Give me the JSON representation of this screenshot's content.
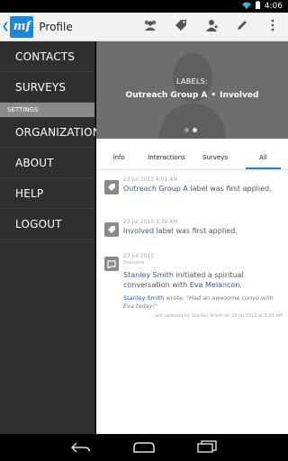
{
  "status_bar": {
    "time": "4:06"
  },
  "action_bar": {
    "logo_text": "mf",
    "title": "Profile",
    "icons": [
      "contacts-group-icon",
      "label-tag-icon",
      "person-icon",
      "edit-pencil-icon",
      "overflow-menu-icon"
    ]
  },
  "drawer": {
    "items_top": [
      {
        "label": "CONTACTS"
      },
      {
        "label": "SURVEYS"
      }
    ],
    "section_label": "SETTINGS",
    "items_bottom": [
      {
        "label": "ORGANIZATION"
      },
      {
        "label": "ABOUT"
      },
      {
        "label": "HELP"
      },
      {
        "label": "LOGOUT"
      }
    ]
  },
  "header": {
    "labels_heading": "LABELS:",
    "label_1": "Outreach Group A",
    "separator": "•",
    "label_2": "Involved",
    "page_dots": 2,
    "active_dot": 2
  },
  "tabs": [
    {
      "label": "Info",
      "active": false
    },
    {
      "label": "Interactions",
      "active": false
    },
    {
      "label": "Surveys",
      "active": false
    },
    {
      "label": "All",
      "active": true
    }
  ],
  "feed": [
    {
      "date": "23 Jul 2013 4:01 AM",
      "highlight": "Outreach Group A",
      "text": " label was first applied."
    },
    {
      "date": "23 Jul 2013 3:39 AM",
      "highlight": "Involved",
      "text": " label was first applied."
    },
    {
      "date": "23 Jul 2013",
      "audience": "Everyone",
      "actor": "Stanley Smith",
      "text_mid": " initiated a spiritual conversation with ",
      "target": "Eva Melancon",
      "text_end": ".",
      "quote_author": "Stanley Smith",
      "quote_verb": " wrote: ",
      "quote_text": "\"Had an awesome convo with Eva today!\"",
      "meta": "- last updated by Stanley Smith on 23 Jul 2013 at 3:39 AM"
    }
  ],
  "colors": {
    "accent": "#1e88d8",
    "drawer_bg": "#2f2f2f",
    "link": "#2a5f9e"
  }
}
